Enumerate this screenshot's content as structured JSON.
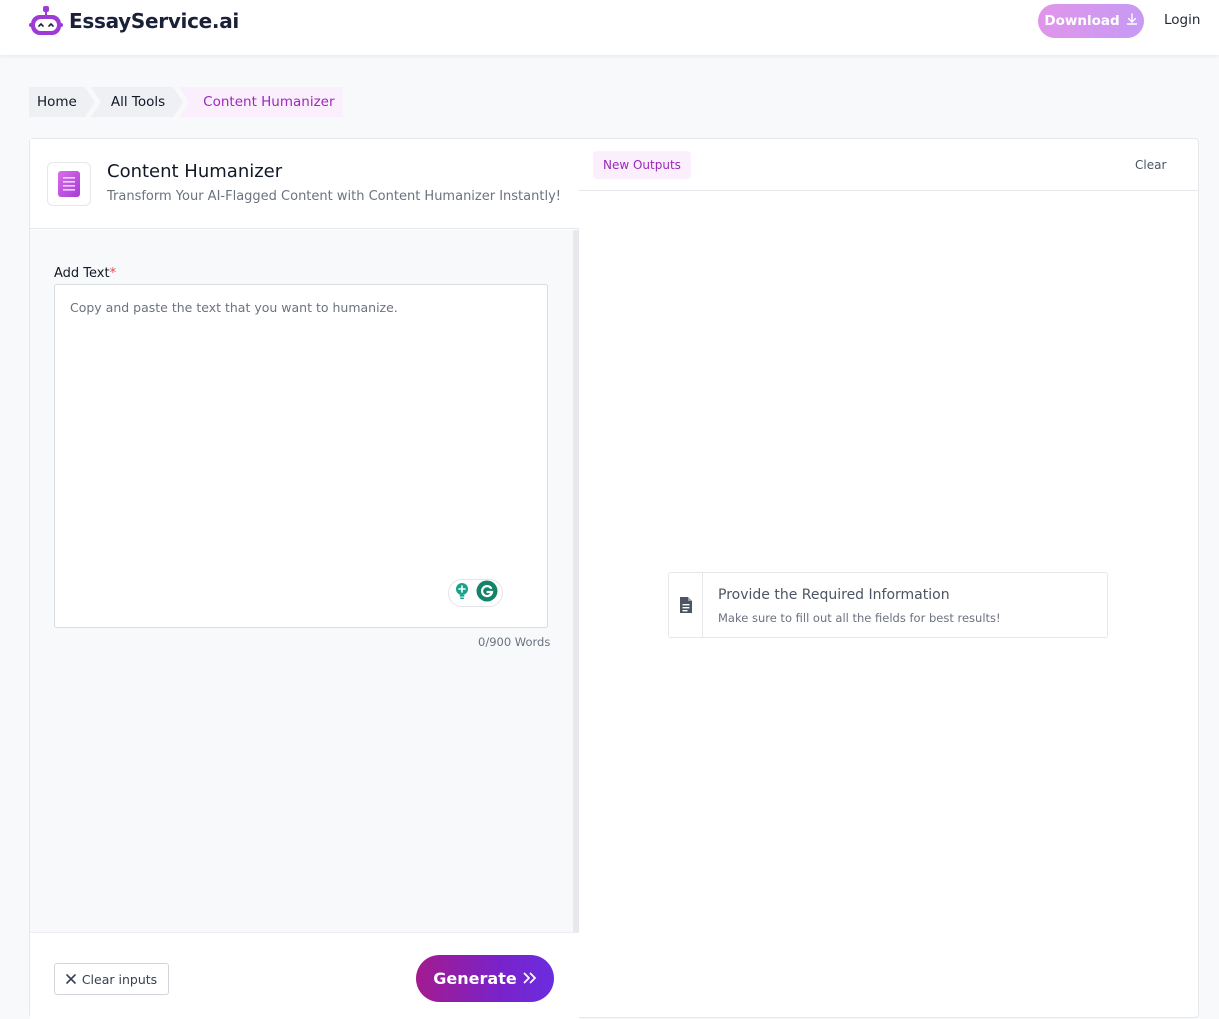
{
  "header": {
    "brand": "EssayService.ai",
    "download_label": "Download",
    "login_label": "Login"
  },
  "breadcrumb": [
    "Home",
    "All Tools",
    "Content Humanizer"
  ],
  "tool": {
    "title": "Content Humanizer",
    "subtitle": "Transform Your AI-Flagged Content with Content Humanizer Instantly!"
  },
  "form": {
    "label": "Add Text",
    "required_mark": "*",
    "placeholder": "Copy and paste the text that you want to humanize.",
    "word_count": "0/900 Words",
    "clear_inputs_label": "Clear inputs",
    "generate_label": "Generate"
  },
  "output": {
    "tab_label": "New Outputs",
    "clear_label": "Clear",
    "empty_title": "Provide the Required Information",
    "empty_subtitle": "Make sure to fill out all the fields for best results!"
  },
  "icons": {
    "logo": "robot-logo-icon",
    "download": "download-arrow-icon",
    "tool": "document-lines-icon",
    "grammarly_bulb": "lightbulb-plus-icon",
    "grammarly": "grammarly-g-icon",
    "clear": "close-x-icon",
    "generate": "double-chevron-right-icon",
    "info": "file-document-icon"
  },
  "colors": {
    "accent": "#9a2ab8",
    "brand_text": "#1a2038",
    "download_gradient_start": "#e195ea",
    "download_gradient_end": "#c69af4",
    "generate_gradient_start": "#a31b8e",
    "generate_gradient_end": "#6a2de0"
  }
}
